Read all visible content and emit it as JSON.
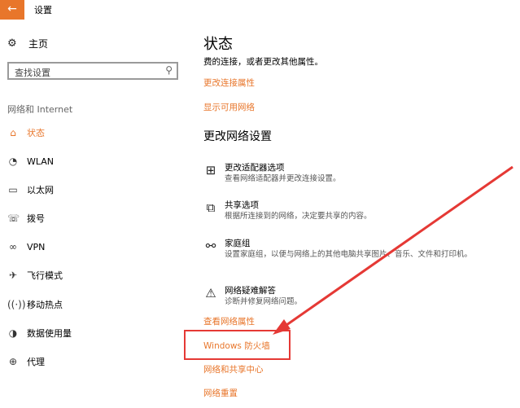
{
  "window": {
    "title": "设置",
    "back_icon": "back-arrow-icon"
  },
  "sidebar": {
    "home_label": "主页",
    "search_placeholder": "查找设置",
    "section_label": "网络和 Internet",
    "items": [
      {
        "label": "状态",
        "icon": "home-status-icon",
        "active": true
      },
      {
        "label": "WLAN",
        "icon": "wifi-icon",
        "active": false
      },
      {
        "label": "以太网",
        "icon": "ethernet-icon",
        "active": false
      },
      {
        "label": "拨号",
        "icon": "dialup-icon",
        "active": false
      },
      {
        "label": "VPN",
        "icon": "vpn-icon",
        "active": false
      },
      {
        "label": "飞行模式",
        "icon": "airplane-icon",
        "active": false
      },
      {
        "label": "移动热点",
        "icon": "hotspot-icon",
        "active": false
      },
      {
        "label": "数据使用量",
        "icon": "data-usage-icon",
        "active": false
      },
      {
        "label": "代理",
        "icon": "globe-icon",
        "active": false
      }
    ]
  },
  "main": {
    "title": "状态",
    "description": "费的连接，或者更改其他属性。",
    "links_top": [
      "更改连接属性",
      "显示可用网络"
    ],
    "change_heading": "更改网络设置",
    "options": [
      {
        "title": "更改适配器选项",
        "desc": "查看网络适配器并更改连接设置。",
        "icon": "adapter-icon"
      },
      {
        "title": "共享选项",
        "desc": "根据所连接到的网络，决定要共享的内容。",
        "icon": "sharing-icon"
      },
      {
        "title": "家庭组",
        "desc": "设置家庭组，以便与网络上的其他电脑共享图片、音乐、文件和打印机。",
        "icon": "homegroup-icon"
      },
      {
        "title": "网络疑难解答",
        "desc": "诊断并修复网络问题。",
        "icon": "warning-icon"
      }
    ],
    "links_bottom": [
      "查看网络属性",
      "Windows 防火墙",
      "网络和共享中心",
      "网络重置"
    ]
  },
  "colors": {
    "accent": "#e8762b",
    "annotation": "#e53935"
  }
}
